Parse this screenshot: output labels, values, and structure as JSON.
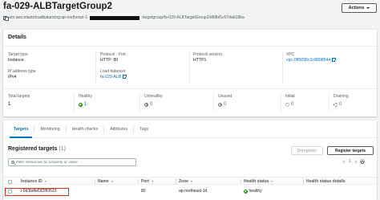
{
  "header": {
    "title": "fa-029-ALBTargetGroup2",
    "actions_label": "Actions",
    "arn_prefix": "arn:aws:elasticloadbalancing:ap-northeast-1:",
    "arn_suffix": ":targetgroup/fa-029-ALBTargetGroup2/d68bf1c07dab18ba"
  },
  "details": {
    "title": "Details",
    "fields": {
      "target_type": {
        "label": "Target type",
        "value": "Instance"
      },
      "protocol_port": {
        "label": "Protocol : Port",
        "value": "HTTP: 80"
      },
      "protocol_version": {
        "label": "Protocol version",
        "value": "HTTP1"
      },
      "vpc": {
        "label": "VPC",
        "value": "vpc-0ff5095c2c8808544"
      },
      "ip_address_type": {
        "label": "IP address type",
        "value": "IPv4"
      },
      "load_balancer": {
        "label": "Load balancer",
        "value": "fa-029-ALB"
      }
    },
    "status": {
      "total": {
        "label": "Total targets",
        "value": "1"
      },
      "healthy": {
        "label": "Healthy",
        "value": "1"
      },
      "unhealthy": {
        "label": "Unhealthy",
        "value": "0"
      },
      "unused": {
        "label": "Unused",
        "value": "0"
      },
      "initial": {
        "label": "Initial",
        "value": "0"
      },
      "draining": {
        "label": "Draining",
        "value": "0"
      }
    }
  },
  "tabs": [
    {
      "label": "Targets",
      "active": true
    },
    {
      "label": "Monitoring",
      "active": false
    },
    {
      "label": "Health checks",
      "active": false
    },
    {
      "label": "Attributes",
      "active": false
    },
    {
      "label": "Tags",
      "active": false
    }
  ],
  "targets": {
    "title": "Registered targets",
    "count": "(1)",
    "deregister_label": "Deregister",
    "register_label": "Register targets",
    "filter_placeholder": "Filter resources by property or value",
    "page": "1",
    "columns": [
      "Instance ID",
      "Name",
      "Port",
      "Zone",
      "Health status",
      "Health status details"
    ],
    "rows": [
      {
        "instance_id": "i-0d3bdfef3f2f83533",
        "name": "",
        "port": "80",
        "zone": "ap-northeast-1d",
        "health": "healthy",
        "details": ""
      }
    ]
  },
  "colors": {
    "link": "#0073bb",
    "healthy": "#1d8102",
    "highlight": "#d13212"
  },
  "icons": [
    "copy-icon",
    "external-link-icon",
    "check-circle-icon",
    "x-circle-icon",
    "minus-circle-icon",
    "search-icon",
    "gear-icon",
    "chevron-left-icon",
    "chevron-right-icon",
    "caret-down-icon"
  ]
}
